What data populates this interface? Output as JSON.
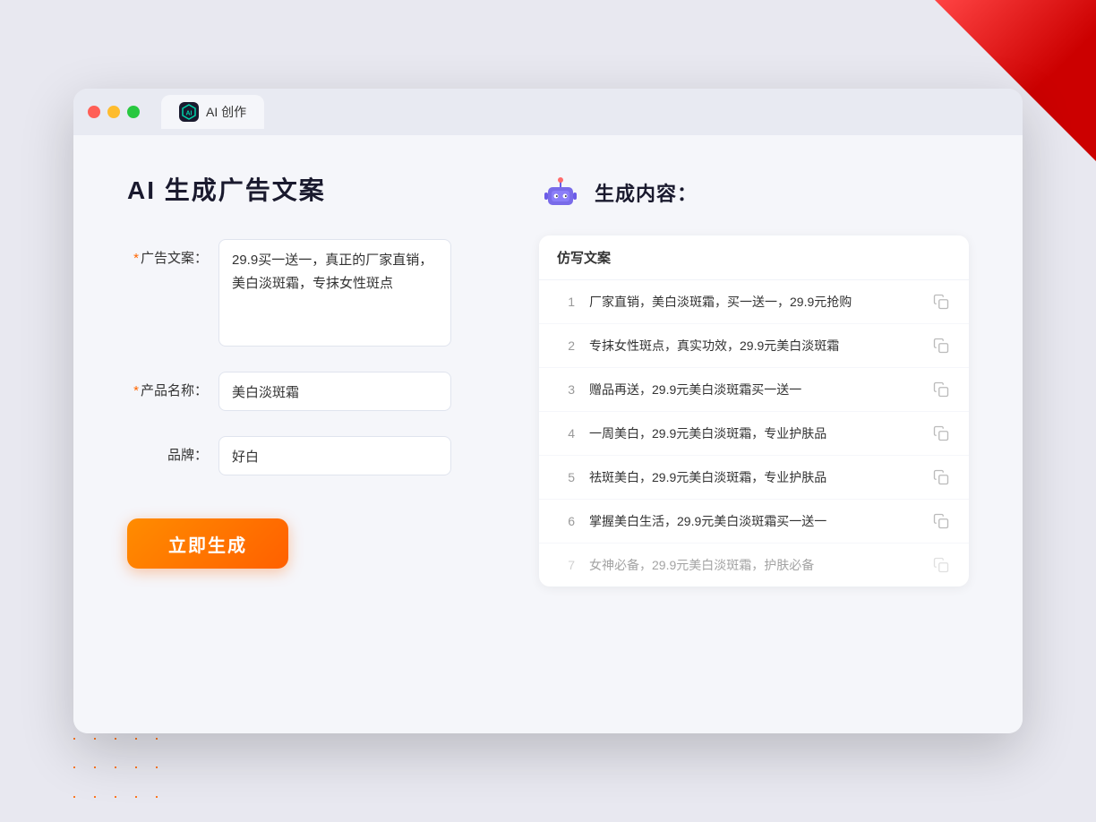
{
  "window": {
    "traffic_lights": [
      "red",
      "yellow",
      "green"
    ],
    "tab": {
      "icon_text": "AI",
      "title": "AI 创作"
    }
  },
  "left_panel": {
    "page_title": "AI 生成广告文案",
    "form": {
      "ad_copy_label": "广告文案：",
      "ad_copy_required": "*",
      "ad_copy_value": "29.9买一送一，真正的厂家直销，美白淡斑霜，专抹女性斑点",
      "product_name_label": "产品名称：",
      "product_name_required": "*",
      "product_name_value": "美白淡斑霜",
      "brand_label": "品牌：",
      "brand_value": "好白"
    },
    "generate_button_label": "立即生成"
  },
  "right_panel": {
    "result_header_title": "生成内容：",
    "table_header": "仿写文案",
    "results": [
      {
        "index": 1,
        "text": "厂家直销，美白淡斑霜，买一送一，29.9元抢购"
      },
      {
        "index": 2,
        "text": "专抹女性斑点，真实功效，29.9元美白淡斑霜"
      },
      {
        "index": 3,
        "text": "赠品再送，29.9元美白淡斑霜买一送一"
      },
      {
        "index": 4,
        "text": "一周美白，29.9元美白淡斑霜，专业护肤品"
      },
      {
        "index": 5,
        "text": "祛斑美白，29.9元美白淡斑霜，专业护肤品"
      },
      {
        "index": 6,
        "text": "掌握美白生活，29.9元美白淡斑霜买一送一"
      },
      {
        "index": 7,
        "text": "女神必备，29.9元美白淡斑霜，护肤必备",
        "faded": true
      }
    ]
  }
}
